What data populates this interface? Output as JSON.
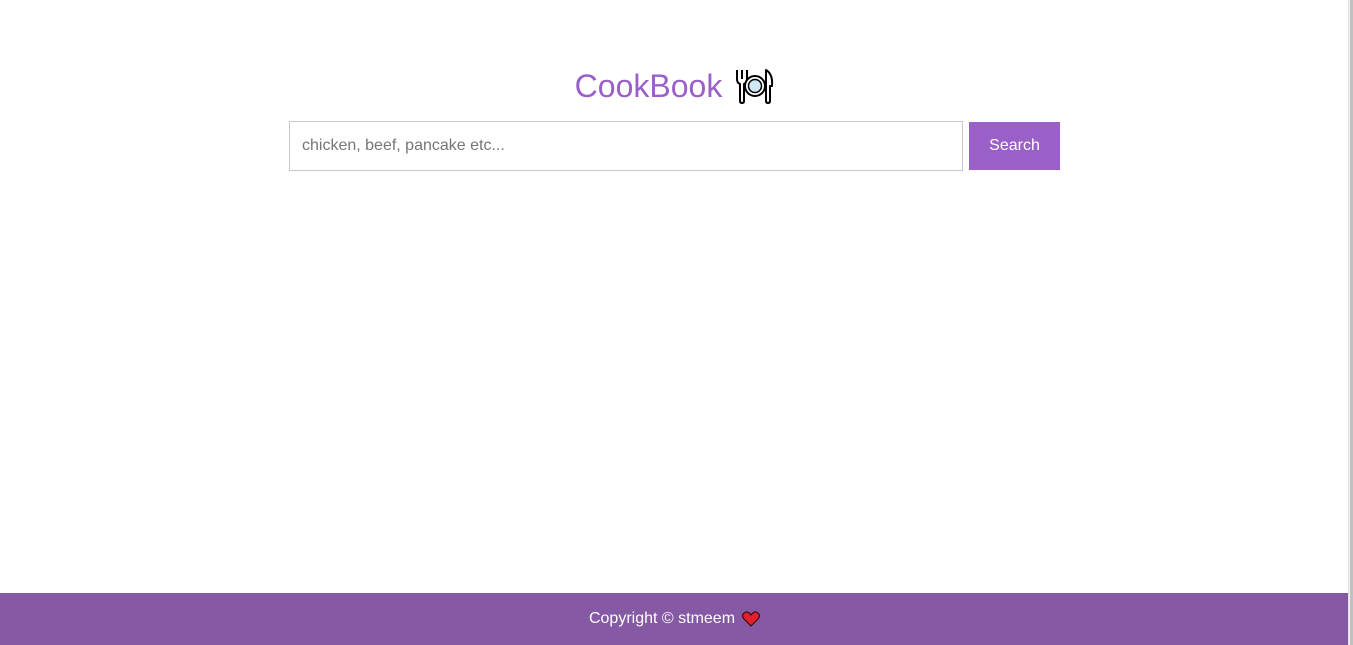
{
  "header": {
    "title": "CookBook",
    "icon": "fork-plate-knife-icon"
  },
  "search": {
    "placeholder": "chicken, beef, pancake etc...",
    "value": "",
    "button_label": "Search"
  },
  "footer": {
    "text": "Copyright © stmeem",
    "icon": "heart-icon"
  },
  "colors": {
    "accent": "#9b5fc8",
    "footer_bg": "#8559a3",
    "heart": "#e3212d"
  }
}
